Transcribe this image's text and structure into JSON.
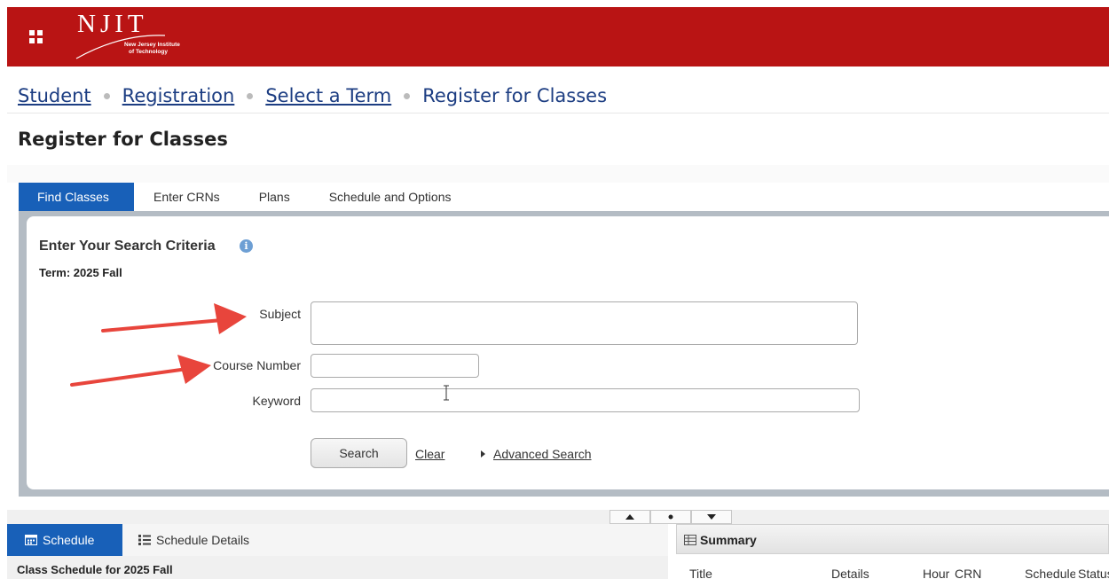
{
  "header": {
    "logo_name": "NJIT",
    "logo_sub1": "New Jersey Institute",
    "logo_sub2": "of Technology",
    "bar_color": "#b91414",
    "menu_icon": "grid-menu-icon"
  },
  "breadcrumb": {
    "items": [
      "Student",
      "Registration",
      "Select a Term"
    ],
    "current": "Register for Classes"
  },
  "page_title": "Register for Classes",
  "tabs": [
    {
      "label": "Find Classes",
      "active": true
    },
    {
      "label": "Enter CRNs",
      "active": false
    },
    {
      "label": "Plans",
      "active": false
    },
    {
      "label": "Schedule and Options",
      "active": false
    }
  ],
  "search": {
    "title": "Enter Your Search Criteria",
    "info_icon": "info-icon",
    "term": "Term: 2025 Fall",
    "subject_label": "Subject",
    "subject_value": "",
    "course_number_label": "Course Number",
    "course_number_value": "",
    "keyword_label": "Keyword",
    "keyword_value": "",
    "search_button": "Search",
    "clear_link": "Clear",
    "advanced_link": "Advanced Search"
  },
  "splitter": {
    "up_icon": "arrow-up-icon",
    "center_icon": "dot-icon",
    "down_icon": "arrow-down-icon"
  },
  "schedule": {
    "tabs": [
      {
        "label": "Schedule",
        "icon": "calendar-icon",
        "active": true
      },
      {
        "label": "Schedule Details",
        "icon": "list-icon",
        "active": false
      }
    ],
    "title": "Class Schedule for 2025 Fall"
  },
  "summary": {
    "title": "Summary",
    "icon": "table-icon",
    "columns": [
      "Title",
      "Details",
      "Hours",
      "CRN",
      "Schedule",
      "Status"
    ]
  },
  "colors": {
    "accent": "#1860b8",
    "link": "#1c3d82",
    "arrow": "#e8453c"
  }
}
